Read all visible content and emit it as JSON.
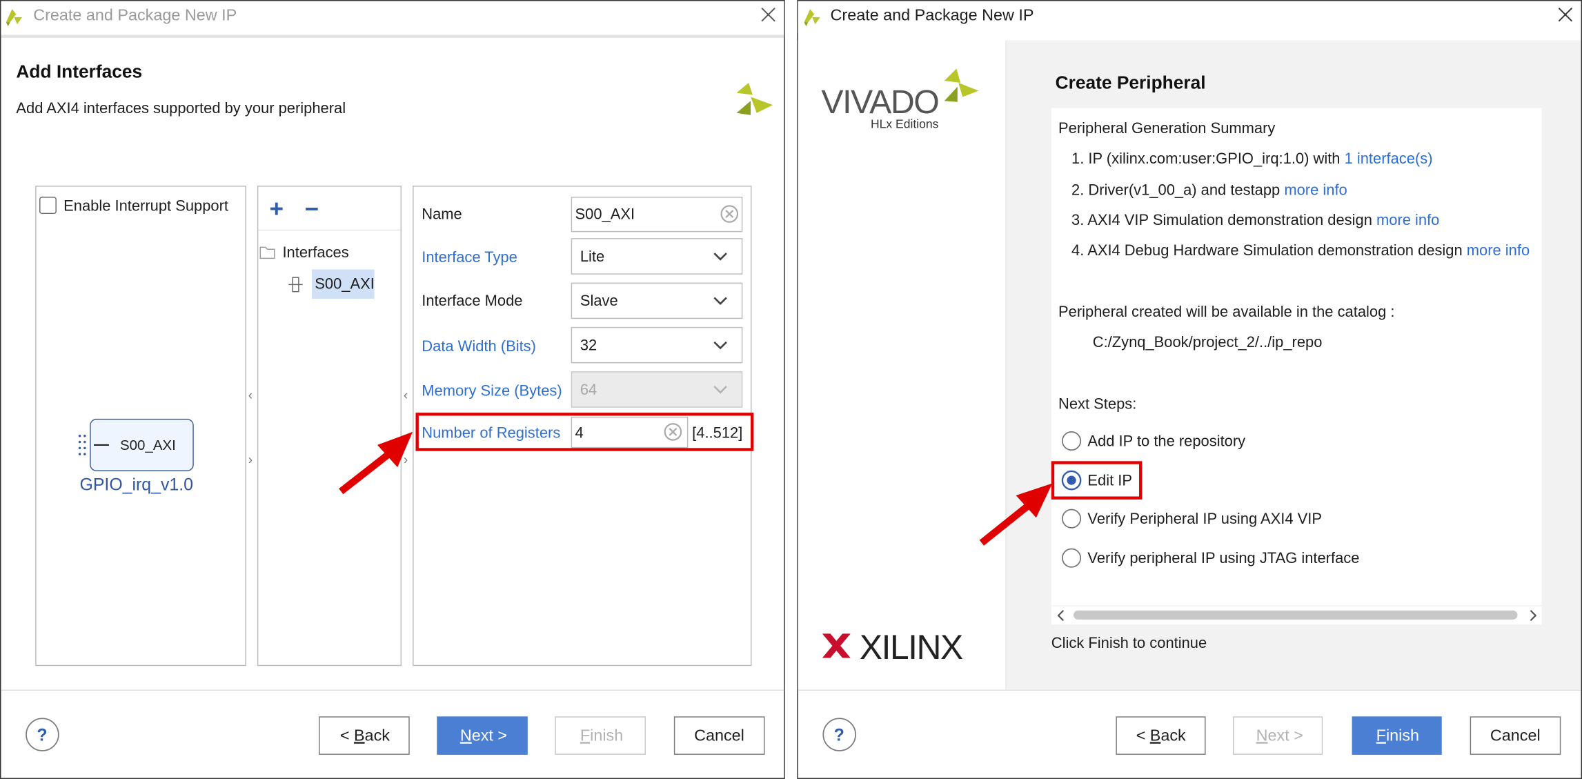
{
  "left_dialog": {
    "window_title": "Create and Package New IP",
    "page_title": "Add Interfaces",
    "page_subtitle": "Add AXI4 interfaces supported by your peripheral",
    "enable_interrupt_label": "Enable Interrupt Support",
    "enable_interrupt_checked": false,
    "block": {
      "port_label": "S00_AXI",
      "ip_name": "GPIO_irq_v1.0"
    },
    "tree": {
      "add_symbol": "+",
      "remove_symbol": "−",
      "folder_label": "Interfaces",
      "item_label": "S00_AXI"
    },
    "form": {
      "name_label": "Name",
      "name_value": "S00_AXI",
      "interface_type_label": "Interface Type",
      "interface_type_value": "Lite",
      "interface_mode_label": "Interface Mode",
      "interface_mode_value": "Slave",
      "data_width_label": "Data Width (Bits)",
      "data_width_value": "32",
      "memory_size_label": "Memory Size (Bytes)",
      "memory_size_value": "64",
      "num_registers_label": "Number of Registers",
      "num_registers_value": "4",
      "num_registers_range": "[4..512]"
    },
    "buttons": {
      "help": "?",
      "back_prefix": "< ",
      "back_key": "B",
      "back_rest": "ack",
      "next_key": "N",
      "next_rest": "ext >",
      "finish_key": "F",
      "finish_rest": "inish",
      "cancel": "Cancel"
    }
  },
  "right_dialog": {
    "window_title": "Create and Package New IP",
    "vivado_logo_text": "VIVADO",
    "vivado_edition_text": "HLx Editions",
    "xilinx_logo_text": "XILINX",
    "page_title": "Create Peripheral",
    "summary_heading": "Peripheral Generation Summary",
    "summary_items": [
      {
        "text": "1. IP (xilinx.com:user:GPIO_irq:1.0) with ",
        "link": "1 interface(s)"
      },
      {
        "text": "2. Driver(v1_00_a) and testapp ",
        "link": "more info"
      },
      {
        "text": "3. AXI4 VIP Simulation demonstration design ",
        "link": "more info"
      },
      {
        "text": "4. AXI4 Debug Hardware Simulation demonstration design ",
        "link": "more info"
      }
    ],
    "catalog_note": "Peripheral created will be available in the catalog :",
    "catalog_path": "C:/Zynq_Book/project_2/../ip_repo",
    "next_steps_label": "Next Steps:",
    "options": [
      {
        "label": "Add IP to the repository",
        "selected": false
      },
      {
        "label": "Edit IP",
        "selected": true
      },
      {
        "label": "Verify Peripheral IP using AXI4 VIP",
        "selected": false
      },
      {
        "label": "Verify peripheral IP using JTAG interface",
        "selected": false
      }
    ],
    "footer_note": "Click Finish to continue",
    "buttons": {
      "help": "?",
      "back_prefix": "< ",
      "back_key": "B",
      "back_rest": "ack",
      "next_key": "N",
      "next_rest": "ext >",
      "finish_key": "F",
      "finish_rest": "inish",
      "cancel": "Cancel"
    }
  },
  "colors": {
    "accent_blue": "#4a7fd4",
    "link_blue": "#2b6fd6",
    "highlight_red": "#e00000",
    "logo_green": "#b8c62a"
  }
}
